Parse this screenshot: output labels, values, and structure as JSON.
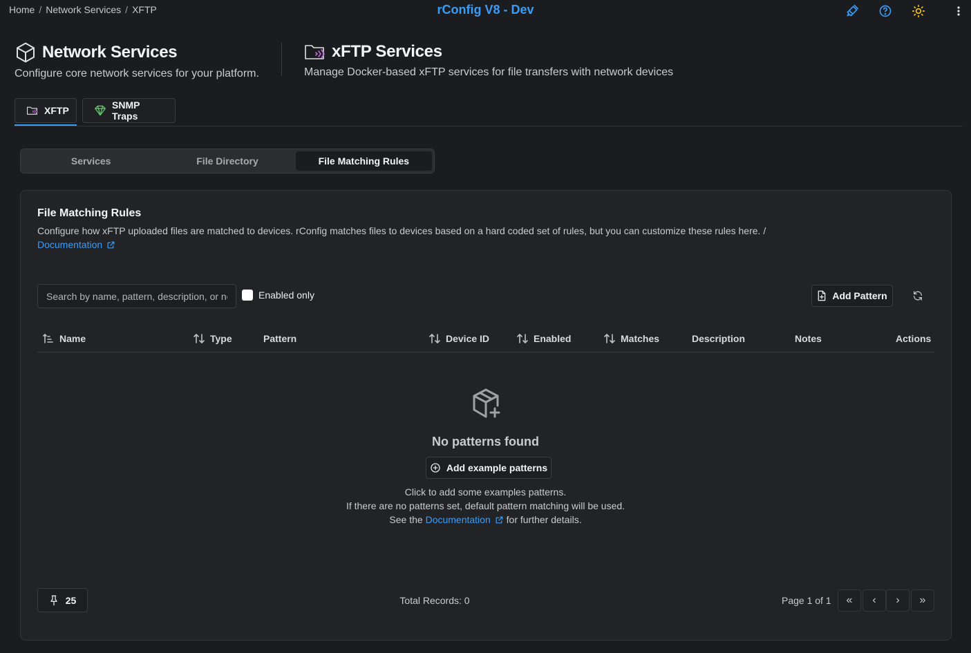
{
  "breadcrumb": {
    "items": [
      "Home",
      "Network Services",
      "XFTP"
    ]
  },
  "app": {
    "title": "rConfig V8 - Dev"
  },
  "top_icons": [
    "brush-icon",
    "help-circle-icon",
    "sun-icon",
    "more-vertical-icon"
  ],
  "network_services": {
    "title": "Network Services",
    "subtitle": "Configure core network services for your platform."
  },
  "xftp_services": {
    "title": "xFTP Services",
    "subtitle": "Manage Docker-based xFTP services for file transfers with network devices"
  },
  "primary_tabs": [
    {
      "label": "XFTP",
      "icon": "folder-signal-icon",
      "active": true
    },
    {
      "label": "SNMP Traps",
      "icon": "trap-icon",
      "active": false
    }
  ],
  "sub_tabs": [
    {
      "label": "Services",
      "active": false
    },
    {
      "label": "File Directory",
      "active": false
    },
    {
      "label": "File Matching Rules",
      "active": true
    }
  ],
  "card": {
    "title": "File Matching Rules",
    "description": "Configure how xFTP uploaded files are matched to devices. rConfig matches files to devices based on a hard coded set of rules, but you can customize these rules here. /",
    "doc_link": "Documentation"
  },
  "toolbar": {
    "search_placeholder": "Search by name, pattern, description, or notes",
    "search_value": "",
    "enabled_only_label": "Enabled only",
    "enabled_only_checked": false,
    "add_pattern_label": "Add Pattern"
  },
  "table": {
    "columns": [
      "Name",
      "Type",
      "Pattern",
      "Device ID",
      "Enabled",
      "Matches",
      "Description",
      "Notes",
      "Actions"
    ]
  },
  "empty_state": {
    "title": "No patterns found",
    "button_label": "Add example patterns",
    "line1": "Click to add some examples patterns.",
    "line2": "If there are no patterns set, default pattern matching will be used.",
    "line3_prefix": "See the",
    "line3_link": "Documentation",
    "line3_suffix": "for further details."
  },
  "footer": {
    "rows_per_page": "25",
    "total_records": "Total Records: 0",
    "page_label": "Page 1 of 1",
    "pager": {
      "first": "«",
      "prev": "‹",
      "next": "›",
      "last": "»"
    }
  },
  "colors": {
    "accent": "#3b9cf5",
    "background": "#1b1c20",
    "card": "#222327",
    "sun": "#f5c518"
  }
}
